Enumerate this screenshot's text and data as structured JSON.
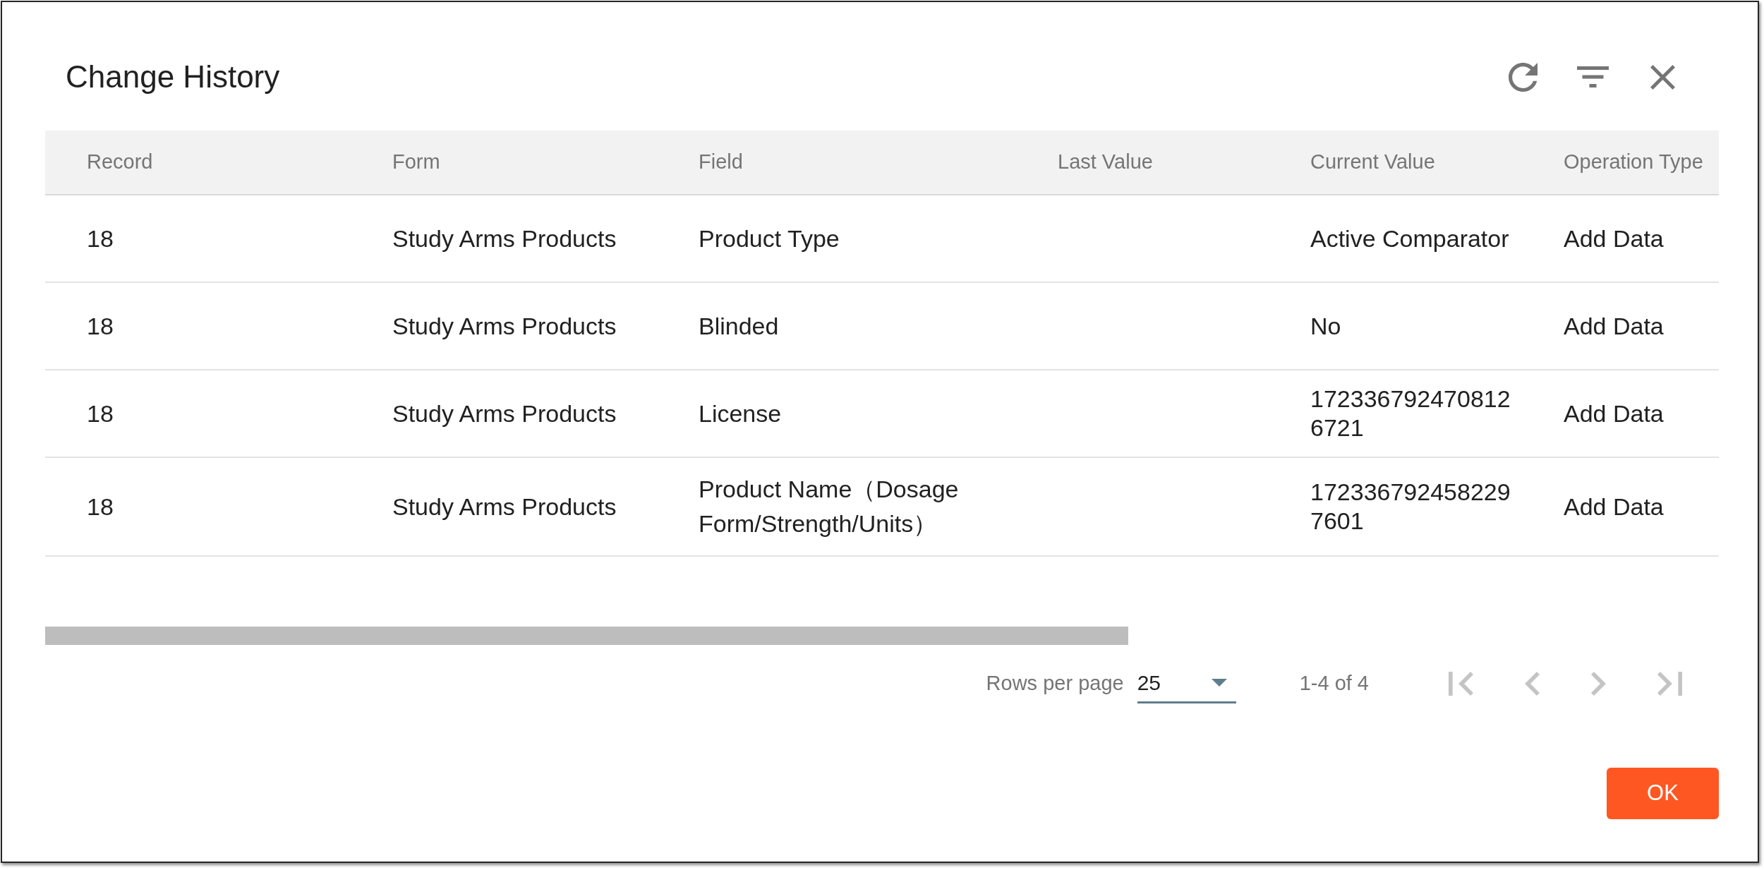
{
  "dialog": {
    "title": "Change History"
  },
  "table": {
    "columns": [
      "Record",
      "Form",
      "Field",
      "Last Value",
      "Current Value",
      "Operation Type"
    ],
    "rows": [
      {
        "record": "18",
        "form": "Study Arms Products",
        "field": "Product Type",
        "current_value": "Active Comparator",
        "operation_type": "Add Data"
      },
      {
        "record": "18",
        "form": "Study Arms Products",
        "field": "Blinded",
        "current_value": "No",
        "operation_type": "Add Data"
      },
      {
        "record": "18",
        "form": "Study Arms Products",
        "field": "License",
        "current_value": "1723367924708126721",
        "operation_type": "Add Data"
      },
      {
        "record": "18",
        "form": "Study Arms Products",
        "field": "Product Name（Dosage Form/Strength/Units）",
        "current_value": "1723367924582297601",
        "operation_type": "Add Data"
      }
    ]
  },
  "pagination": {
    "rows_per_page_label": "Rows per page",
    "rows_per_page": "25",
    "range": "1-4 of 4",
    "buttons": [
      {
        "disabled": true
      },
      {
        "disabled": true
      },
      {
        "disabled": true
      },
      {
        "disabled": true
      }
    ]
  },
  "actions": [
    "OK"
  ]
}
